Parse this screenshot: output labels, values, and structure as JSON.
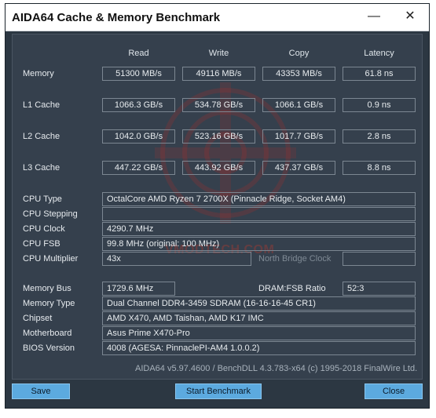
{
  "window": {
    "title": "AIDA64 Cache & Memory Benchmark",
    "minimize_glyph": "—",
    "close_glyph": "✕"
  },
  "columns": [
    "Read",
    "Write",
    "Copy",
    "Latency"
  ],
  "bench_rows": [
    {
      "label": "Memory",
      "values": [
        "51300 MB/s",
        "49116 MB/s",
        "43353 MB/s",
        "61.8 ns"
      ]
    },
    {
      "label": "L1 Cache",
      "values": [
        "1066.3 GB/s",
        "534.78 GB/s",
        "1066.1 GB/s",
        "0.9 ns"
      ]
    },
    {
      "label": "L2 Cache",
      "values": [
        "1042.0 GB/s",
        "523.16 GB/s",
        "1017.7 GB/s",
        "2.8 ns"
      ]
    },
    {
      "label": "L3 Cache",
      "values": [
        "447.22 GB/s",
        "443.92 GB/s",
        "437.37 GB/s",
        "8.8 ns"
      ]
    }
  ],
  "cpu": {
    "type_label": "CPU Type",
    "type_value": "OctalCore AMD Ryzen 7 2700X  (Pinnacle Ridge, Socket AM4)",
    "stepping_label": "CPU Stepping",
    "stepping_value": "",
    "clock_label": "CPU Clock",
    "clock_value": "4290.7 MHz",
    "fsb_label": "CPU FSB",
    "fsb_value": "99.8 MHz  (original: 100 MHz)",
    "multiplier_label": "CPU Multiplier",
    "multiplier_value": "43x",
    "northbridge_label": "North Bridge Clock",
    "northbridge_value": ""
  },
  "memory": {
    "bus_label": "Memory Bus",
    "bus_value": "1729.6 MHz",
    "ratio_label": "DRAM:FSB Ratio",
    "ratio_value": "52:3",
    "type_label": "Memory Type",
    "type_value": "Dual Channel DDR4-3459 SDRAM  (16-16-16-45 CR1)",
    "chipset_label": "Chipset",
    "chipset_value": "AMD X470, AMD Taishan, AMD K17 IMC",
    "motherboard_label": "Motherboard",
    "motherboard_value": "Asus Prime X470-Pro",
    "bios_label": "BIOS Version",
    "bios_value": "4008  (AGESA: PinnaclePI-AM4 1.0.0.2)"
  },
  "footer": "AIDA64 v5.97.4600 / BenchDLL 4.3.783-x64  (c) 1995-2018 FinalWire Ltd.",
  "watermark": "VMODTECH.COM",
  "buttons": {
    "save": "Save",
    "start": "Start Benchmark",
    "close": "Close"
  },
  "colors": {
    "accent": "#5caadf",
    "panel": "#35404d",
    "frame": "#2c3742"
  }
}
